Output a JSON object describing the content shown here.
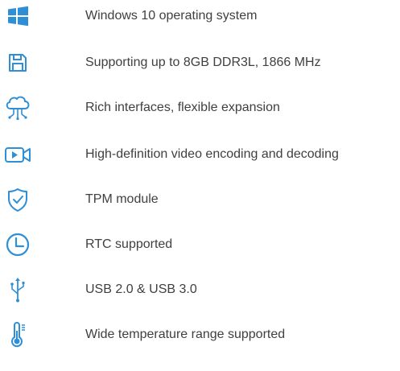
{
  "accent_color": "#2f8fd6",
  "text_color": "#404040",
  "features": [
    {
      "icon": "windows-logo-icon",
      "label": "Windows 10 operating system"
    },
    {
      "icon": "floppy-disk-icon",
      "label": "Supporting up to 8GB DDR3L, 1866 MHz"
    },
    {
      "icon": "cloud-network-icon",
      "label": "Rich interfaces, flexible expansion"
    },
    {
      "icon": "video-camera-icon",
      "label": "High-definition video encoding and decoding"
    },
    {
      "icon": "shield-check-icon",
      "label": "TPM module"
    },
    {
      "icon": "clock-icon",
      "label": "RTC supported"
    },
    {
      "icon": "usb-icon",
      "label": "USB 2.0 & USB 3.0"
    },
    {
      "icon": "thermometer-icon",
      "label": "Wide temperature range supported"
    }
  ]
}
